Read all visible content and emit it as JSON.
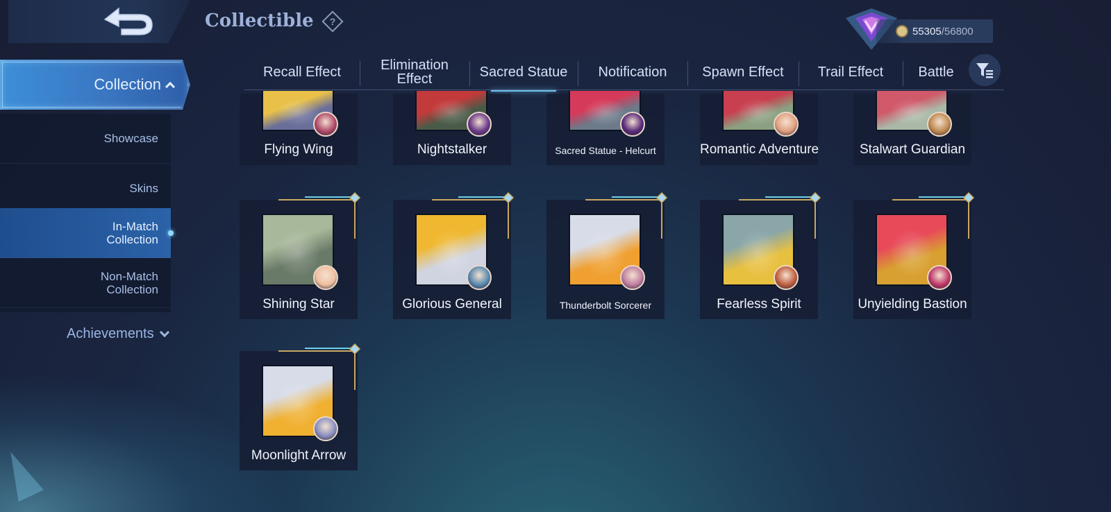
{
  "header": {
    "title": "Collectible",
    "points_current": "55305",
    "points_separator": "/",
    "points_max": "56800"
  },
  "nav": {
    "collection_label": "Collection",
    "sub_items": [
      {
        "label": "Showcase"
      },
      {
        "label": "Skins"
      },
      {
        "label": "In-Match\nCollection"
      },
      {
        "label": "Non-Match\nCollection"
      }
    ],
    "achievements_label": "Achievements"
  },
  "tabs": [
    {
      "label": "Recall Effect"
    },
    {
      "label": "Elimination\nEffect"
    },
    {
      "label": "Sacred Statue",
      "active": true
    },
    {
      "label": "Notification"
    },
    {
      "label": "Spawn Effect"
    },
    {
      "label": "Trail Effect"
    },
    {
      "label": "Battle"
    }
  ],
  "cards": [
    {
      "label": "Flying Wing",
      "colors": [
        "#e8c04a",
        "#6a6f9a"
      ],
      "badge": "#b04a6a"
    },
    {
      "label": "Nightstalker",
      "colors": [
        "#c23a3a",
        "#4a5a48"
      ],
      "badge": "#6a3a8a"
    },
    {
      "label": "Sacred Statue - Helcurt",
      "colors": [
        "#d63a5a",
        "#6c7a8a"
      ],
      "badge": "#5a2a7a"
    },
    {
      "label": "Romantic Adventure",
      "colors": [
        "#c84050",
        "#8aa080"
      ],
      "badge": "#e0a080"
    },
    {
      "label": "Stalwart Guardian",
      "colors": [
        "#d05a6a",
        "#aab8a8"
      ],
      "badge": "#c08a50"
    },
    {
      "label": "Shining Star",
      "colors": [
        "#a8b89a",
        "#6a7a68"
      ],
      "badge": "#f0c0a0"
    },
    {
      "label": "Glorious General",
      "colors": [
        "#f0b830",
        "#d0d4e0"
      ],
      "badge": "#5a8ab0"
    },
    {
      "label": "Thunderbolt Sorcerer",
      "colors": [
        "#d8dce8",
        "#f0a030"
      ],
      "badge": "#c080a0"
    },
    {
      "label": "Fearless Spirit",
      "colors": [
        "#8aa6a8",
        "#e8c040"
      ],
      "badge": "#c06040"
    },
    {
      "label": "Unyielding Bastion",
      "colors": [
        "#e84a5a",
        "#d8a030"
      ],
      "badge": "#c03a6a"
    },
    {
      "label": "Moonlight Arrow",
      "colors": [
        "#d8dce8",
        "#f0b030"
      ],
      "badge": "#8a90c0"
    }
  ],
  "colors": {
    "accent": "#3d8fd8",
    "tab_underline": "#6fc3ee",
    "gold_trim": "#c8a860"
  }
}
